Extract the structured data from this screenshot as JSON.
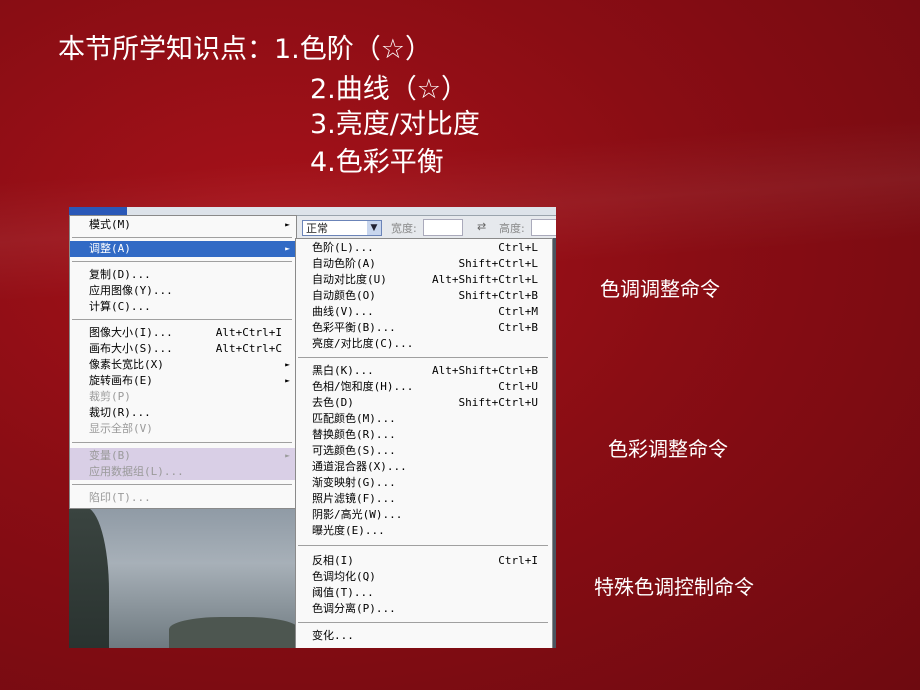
{
  "slide": {
    "heading_lines": [
      "本节所学知识点：1.色阶（☆）",
      "2.曲线（☆）",
      "3.亮度/对比度",
      "4.色彩平衡"
    ],
    "side_labels": [
      "色调调整命令",
      "色彩调整命令",
      "特殊色调控制命令"
    ]
  },
  "options_bar": {
    "mode_value": "正常",
    "width_label": "宽度:",
    "swap_icon": "⇄",
    "height_label": "高度:"
  },
  "image_menu": {
    "items": [
      {
        "label": "模式(M)",
        "arrow": "►"
      },
      {
        "label": "调整(A)",
        "arrow": "►"
      },
      {
        "label": "复制(D)..."
      },
      {
        "label": "应用图像(Y)..."
      },
      {
        "label": "计算(C)..."
      },
      {
        "label": "图像大小(I)...",
        "shortcut": "Alt+Ctrl+I"
      },
      {
        "label": "画布大小(S)...",
        "shortcut": "Alt+Ctrl+C"
      },
      {
        "label": "像素长宽比(X)",
        "arrow": "►"
      },
      {
        "label": "旋转画布(E)",
        "arrow": "►"
      },
      {
        "label": "裁剪(P)"
      },
      {
        "label": "裁切(R)..."
      },
      {
        "label": "显示全部(V)"
      },
      {
        "label": "变量(B)",
        "arrow": "►"
      },
      {
        "label": "应用数据组(L)..."
      },
      {
        "label": "陷印(T)..."
      }
    ]
  },
  "adjust_menu": {
    "items": [
      {
        "label": "色阶(L)...",
        "shortcut": "Ctrl+L"
      },
      {
        "label": "自动色阶(A)",
        "shortcut": "Shift+Ctrl+L"
      },
      {
        "label": "自动对比度(U)",
        "shortcut": "Alt+Shift+Ctrl+L"
      },
      {
        "label": "自动颜色(O)",
        "shortcut": "Shift+Ctrl+B"
      },
      {
        "label": "曲线(V)...",
        "shortcut": "Ctrl+M"
      },
      {
        "label": "色彩平衡(B)...",
        "shortcut": "Ctrl+B"
      },
      {
        "label": "亮度/对比度(C)..."
      },
      {
        "label": "黑白(K)...",
        "shortcut": "Alt+Shift+Ctrl+B"
      },
      {
        "label": "色相/饱和度(H)...",
        "shortcut": "Ctrl+U"
      },
      {
        "label": "去色(D)",
        "shortcut": "Shift+Ctrl+U"
      },
      {
        "label": "匹配颜色(M)..."
      },
      {
        "label": "替换颜色(R)..."
      },
      {
        "label": "可选颜色(S)..."
      },
      {
        "label": "通道混合器(X)..."
      },
      {
        "label": "渐变映射(G)..."
      },
      {
        "label": "照片滤镜(F)..."
      },
      {
        "label": "阴影/高光(W)..."
      },
      {
        "label": "曝光度(E)..."
      },
      {
        "label": "反相(I)",
        "shortcut": "Ctrl+I"
      },
      {
        "label": "色调均化(Q)"
      },
      {
        "label": "阈值(T)..."
      },
      {
        "label": "色调分离(P)..."
      },
      {
        "label": "变化..."
      }
    ]
  }
}
